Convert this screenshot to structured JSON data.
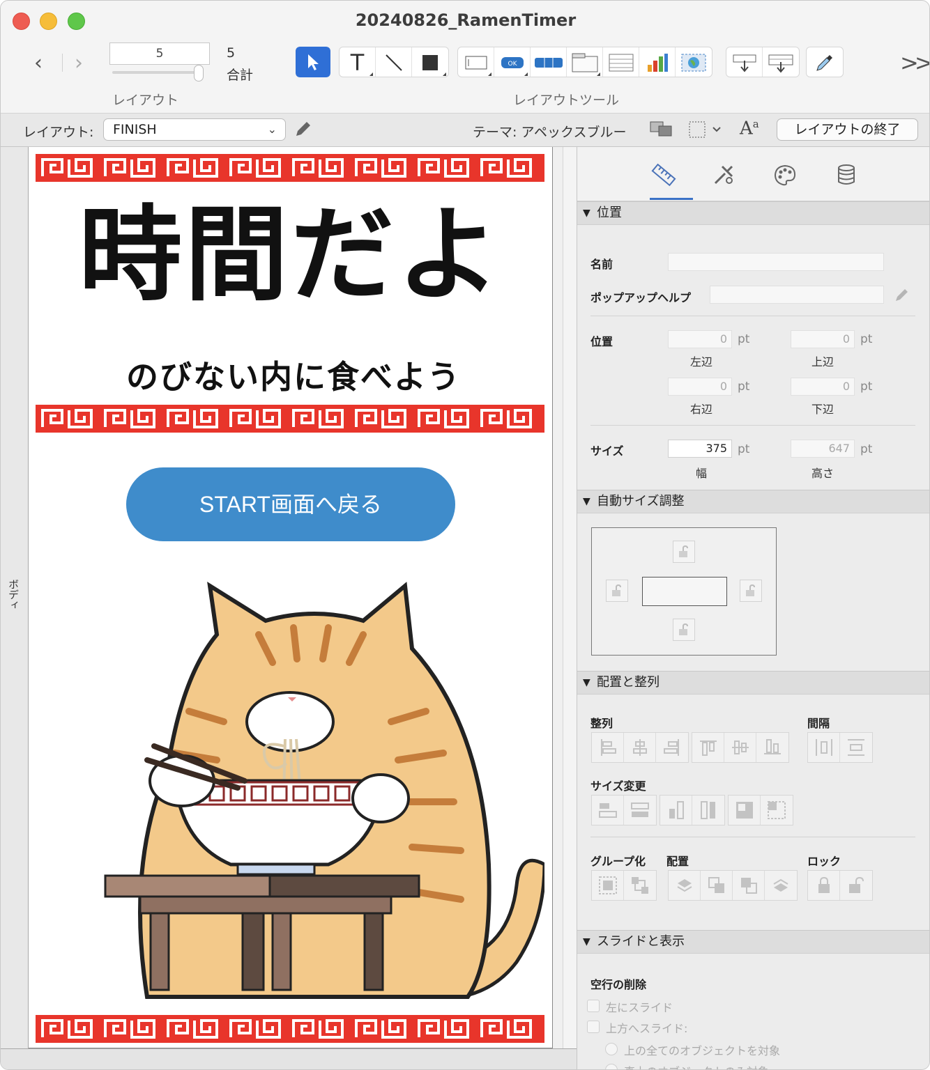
{
  "window": {
    "title": "20240826_RamenTimer"
  },
  "toolbar": {
    "record_field": "5",
    "record_total_value": "5",
    "record_total_label": "合計",
    "layout_group_label": "レイアウト",
    "tools_group_label": "レイアウトツール",
    "tools": [
      "pointer-tool",
      "text-tool",
      "line-tool",
      "shape-tool",
      "field-tool",
      "button-tool",
      "button-bar-tool",
      "tab-control-tool",
      "portal-tool",
      "chart-tool",
      "web-viewer-tool",
      "insert-field-tool",
      "insert-part-tool",
      "format-painter-tool"
    ],
    "overflow_label": ">>"
  },
  "layout_bar": {
    "layout_label": "レイアウト:",
    "layout_value": "FINISH",
    "theme_label": "テーマ: アペックスブルー",
    "exit_button": "レイアウトの終了"
  },
  "canvas": {
    "part_label": "ボディ",
    "headline": "時間だよ",
    "subline": "のびない内に食べよう",
    "start_button": "START画面へ戻る",
    "accent_color": "#e8352b",
    "button_color": "#3f8ccb"
  },
  "inspector": {
    "tabs": [
      "position-tab",
      "appearance-tab",
      "palette-tab",
      "data-tab"
    ],
    "position_section": {
      "header": "位置",
      "name_label": "名前",
      "name_value": "",
      "popup_help_label": "ポップアップヘルプ",
      "popup_help_value": "",
      "position_label": "位置",
      "left_value": "0",
      "left_label": "左辺",
      "top_value": "0",
      "top_label": "上辺",
      "right_value": "0",
      "right_label": "右辺",
      "bottom_value": "0",
      "bottom_label": "下辺",
      "unit": "pt",
      "size_label": "サイズ",
      "width_value": "375",
      "width_label": "幅",
      "height_value": "647",
      "height_label": "高さ"
    },
    "autosize_section": {
      "header": "自動サイズ調整"
    },
    "arrange_section": {
      "header": "配置と整列",
      "align_label": "整列",
      "spacing_label": "間隔",
      "resize_label": "サイズ変更",
      "group_label": "グループ化",
      "arrange_label": "配置",
      "lock_label": "ロック"
    },
    "slide_section": {
      "header": "スライドと表示",
      "remove_blank_label": "空行の削除",
      "slide_left": "左にスライド",
      "slide_up": "上方へスライド:",
      "option_all": "上の全てのオブジェクトを対象",
      "option_directly": "真上のオブジェクトのみ対象"
    }
  }
}
